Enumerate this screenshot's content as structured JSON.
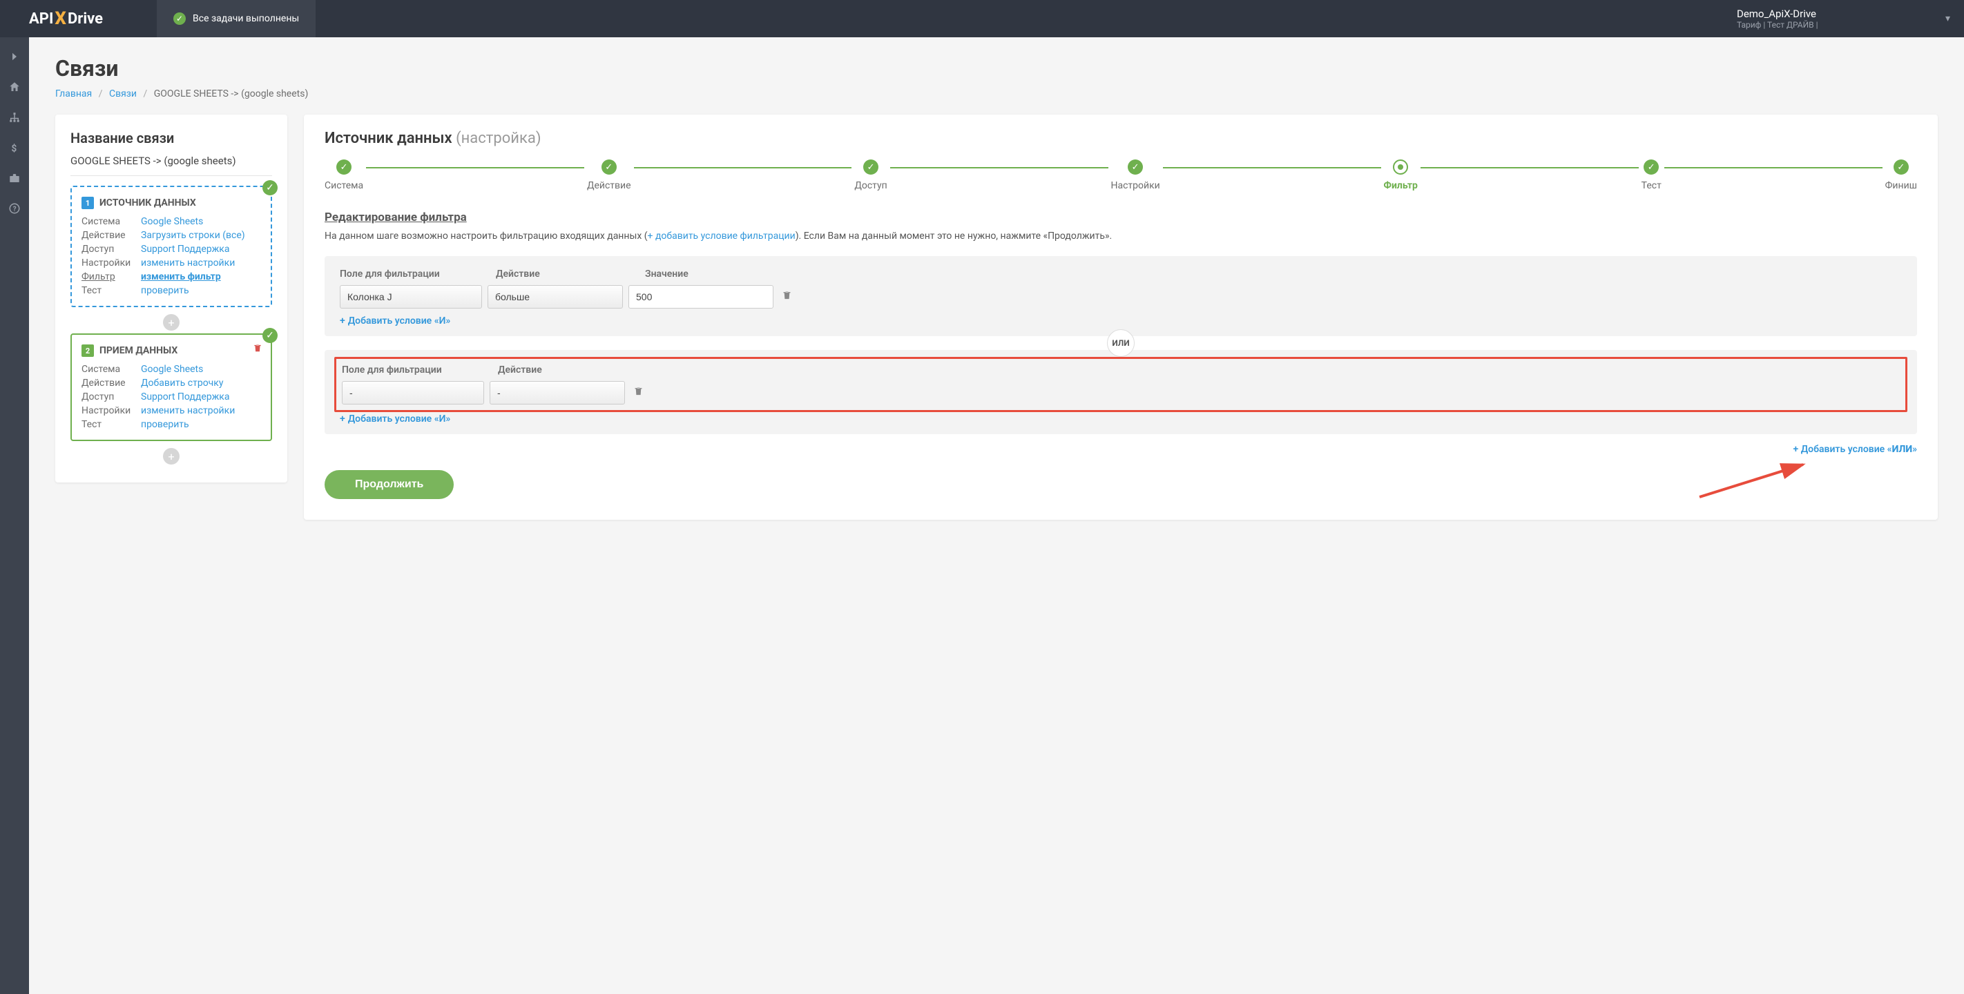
{
  "topbar": {
    "logo_api": "API",
    "logo_x": "X",
    "logo_drive": "Drive",
    "tasks_done": "Все задачи выполнены",
    "account_name": "Demo_ApiX-Drive",
    "tariff_line": "Тариф | Тест ДРАЙВ |"
  },
  "page": {
    "title": "Связи"
  },
  "breadcrumb": {
    "home": "Главная",
    "links": "Связи",
    "current": "GOOGLE SHEETS -> (google sheets)"
  },
  "left": {
    "heading": "Название связи",
    "conn_name": "GOOGLE SHEETS -> (google sheets)",
    "source": {
      "title": "ИСТОЧНИК ДАННЫХ",
      "rows": {
        "system_k": "Система",
        "system_v": "Google Sheets",
        "action_k": "Действие",
        "action_v": "Загрузить строки (все)",
        "access_k": "Доступ",
        "access_v": "Support Поддержка",
        "settings_k": "Настройки",
        "settings_v": "изменить настройки",
        "filter_k": "Фильтр",
        "filter_v": "изменить фильтр",
        "test_k": "Тест",
        "test_v": "проверить"
      }
    },
    "dest": {
      "title": "ПРИЕМ ДАННЫХ",
      "rows": {
        "system_k": "Система",
        "system_v": "Google Sheets",
        "action_k": "Действие",
        "action_v": "Добавить строчку",
        "access_k": "Доступ",
        "access_v": "Support Поддержка",
        "settings_k": "Настройки",
        "settings_v": "изменить настройки",
        "test_k": "Тест",
        "test_v": "проверить"
      }
    }
  },
  "right": {
    "title_main": "Источник данных",
    "title_sub": "(настройка)",
    "steps": {
      "s1": "Система",
      "s2": "Действие",
      "s3": "Доступ",
      "s4": "Настройки",
      "s5": "Фильтр",
      "s6": "Тест",
      "s7": "Финиш"
    },
    "filter_heading": "Редактирование фильтра",
    "filter_desc_1": "На данном шаге возможно настроить фильтрацию входящих данных (",
    "filter_desc_link": "+ добавить условие фильтрации",
    "filter_desc_2": "). Если Вам на данный момент это не нужно, нажмите «Продолжить».",
    "labels": {
      "field": "Поле для фильтрации",
      "action": "Действие",
      "value": "Значение"
    },
    "group1": {
      "field": "Колонка J",
      "action": "больше",
      "value": "500"
    },
    "group2": {
      "field": "-",
      "action": "-"
    },
    "or_label": "ИЛИ",
    "add_and": "Добавить условие «И»",
    "add_or_prefix": "+ Добавить условие «",
    "add_or_bold": "ИЛИ",
    "add_or_suffix": "»",
    "continue": "Продолжить"
  }
}
